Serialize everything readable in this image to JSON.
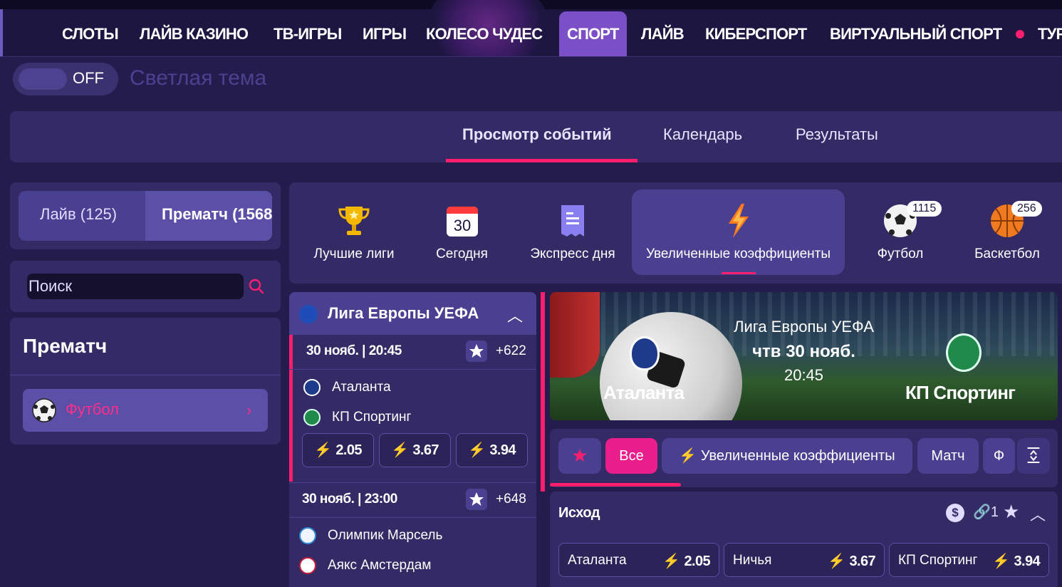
{
  "nav": {
    "items": [
      "СЛОТЫ",
      "ЛАЙВ КАЗИНО",
      "ТВ-ИГРЫ",
      "ИГРЫ",
      "КОЛЕСО ЧУДЕС",
      "СПОРТ",
      "ЛАЙВ",
      "КИБЕРСПОРТ",
      "ВИРТУАЛЬНЫЙ СПОРТ",
      "ТУР"
    ],
    "active": "СПОРТ",
    "accent_color": "#7b4fc7"
  },
  "theme": {
    "toggle_state": "OFF",
    "label": "Светлая тема"
  },
  "tabs": {
    "items": [
      "Просмотр событий",
      "Календарь",
      "Результаты"
    ],
    "active": "Просмотр событий"
  },
  "mode": {
    "live": "Лайв (125)",
    "prematch": "Прематч (1568"
  },
  "search": {
    "placeholder": "Поиск"
  },
  "sidebar": {
    "title": "Прематч",
    "sport": "Футбол"
  },
  "categories": [
    {
      "label": "Лучшие лиги",
      "icon": "trophy-icon"
    },
    {
      "label": "Сегодня",
      "icon": "calendar-icon",
      "day": "30"
    },
    {
      "label": "Экспресс дня",
      "icon": "receipt-icon"
    },
    {
      "label": "Увеличенные коэффициенты",
      "icon": "lightning-icon",
      "active": true
    },
    {
      "label": "Футбол",
      "icon": "soccer-ball-icon",
      "count": "1115"
    },
    {
      "label": "Баскетбол",
      "icon": "basketball-icon",
      "count": "256"
    }
  ],
  "league": {
    "name": "Лига Европы УЕФА"
  },
  "events": [
    {
      "date": "30 нояб. | 20:45",
      "more": "+622",
      "home": "Аталанта",
      "away": "КП Спортинг",
      "odds": [
        "2.05",
        "3.67",
        "3.94"
      ]
    },
    {
      "date": "30 нояб. | 23:00",
      "more": "+648",
      "home": "Олимпик Марсель",
      "away": "Аякс Амстердам"
    }
  ],
  "hero": {
    "league": "Лига Европы УЕФА",
    "date": "чтв 30 нояб.",
    "time": "20:45",
    "home": "Аталанта",
    "away": "КП Спортинг"
  },
  "filters": [
    "Все",
    "Увеличенные коэффициенты",
    "Матч",
    "Ф"
  ],
  "market": {
    "title": "Исход",
    "links": "1",
    "outcomes": [
      {
        "name": "Аталанта",
        "odd": "2.05"
      },
      {
        "name": "Ничья",
        "odd": "3.67"
      },
      {
        "name": "КП Спортинг",
        "odd": "3.94"
      }
    ]
  },
  "colors": {
    "accent_pink": "#ff1e6e",
    "bolt_orange": "#ff7a1a",
    "panel": "#342a66"
  }
}
